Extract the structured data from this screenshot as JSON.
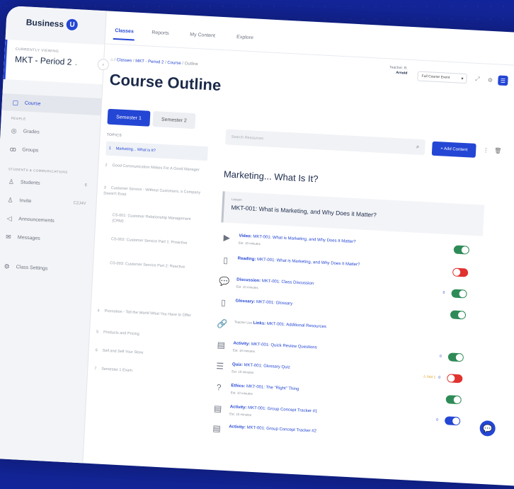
{
  "brand": {
    "name": "Business",
    "badge": "U"
  },
  "topnav": {
    "tabs": [
      {
        "label": "Classes"
      },
      {
        "label": "Reports"
      },
      {
        "label": "My Content"
      },
      {
        "label": "Explore"
      }
    ]
  },
  "class_selector": {
    "label": "CURRENTLY VIEWING",
    "value": "MKT - Period 2"
  },
  "sidebar": {
    "course": "Course",
    "section_people": "PEOPLE",
    "grades": "Grades",
    "groups": "Groups",
    "section_comm": "STUDENTS & COMMUNICATIONS",
    "students": "Students",
    "students_count": "6",
    "invite": "Invite",
    "invite_code": "C2J4V",
    "announcements": "Announcements",
    "messages": "Messages",
    "class_settings": "Class Settings"
  },
  "breadcrumb": {
    "home": "⌂",
    "classes": "Classes",
    "period": "MKT - Period 2",
    "course": "Course",
    "current": "Outline"
  },
  "page_title": "Course Outline",
  "header_right": {
    "teacher_label": "Teacher: R.",
    "teacher_name": "Arnold",
    "view_select": "Full Course Event"
  },
  "semesters": [
    "Semester 1",
    "Semester 2"
  ],
  "topics_label": "TOPICS",
  "topics": [
    {
      "num": "1",
      "label": "Marketing... What is It?"
    },
    {
      "num": "2",
      "label": "Good Communication Makes For A Good Manager"
    },
    {
      "num": "3",
      "label": "Customer Service - Without Customers, a Company Doesn't Exist"
    },
    {
      "num": "",
      "label": "CS-001: Customer Relationship Management (CRM)"
    },
    {
      "num": "",
      "label": "CS-002: Customer Service Part 1: Proactive"
    },
    {
      "num": "",
      "label": "CS-003: Customer Service Part 2: Reactive"
    },
    {
      "num": "4",
      "label": "Promotion - Tell the World What You Have to Offer"
    },
    {
      "num": "5",
      "label": "Products and Pricing"
    },
    {
      "num": "6",
      "label": "Sell and Sell Your Store"
    },
    {
      "num": "7",
      "label": "Semester 1 Exam"
    }
  ],
  "search": {
    "placeholder": "Search Resources"
  },
  "add_content": "+ Add Content",
  "section_title": "Marketing... What Is It?",
  "lesson": {
    "label": "Lesson",
    "title": "MKT-001: What is Marketing, and Why Does it Matter?"
  },
  "items": [
    {
      "icon": "▶",
      "icon_name": "video-icon",
      "kind": "Video:",
      "title": "MKT-001: What is Marketing, and Why Does It Matter?",
      "meta": "Est. 10 minutes",
      "toggle": "on",
      "count": ""
    },
    {
      "icon": "▯",
      "icon_name": "document-icon",
      "kind": "Reading:",
      "title": "MKT-001: What is Marketing, and Why Does It Matter?",
      "meta": "",
      "toggle": "off",
      "count": ""
    },
    {
      "icon": "💬",
      "icon_name": "discussion-icon",
      "kind": "Discussion:",
      "title": "MKT-001: Class Discussion",
      "meta": "Est. 10 minutes",
      "toggle": "on",
      "count": "0"
    },
    {
      "icon": "▯",
      "icon_name": "document-icon",
      "kind": "Glossary:",
      "title": "MKT-001: Glossary",
      "meta": "",
      "toggle": "on",
      "count": ""
    },
    {
      "icon": "🔗",
      "icon_name": "link-icon",
      "kind": "Links:",
      "prefix": "Teacher Use",
      "title": "MKT-001: Additional Resources",
      "meta": "",
      "toggle": "",
      "count": ""
    },
    {
      "icon": "▤",
      "icon_name": "activity-icon",
      "kind": "Activity:",
      "title": "MKT-001: Quick Review Questions",
      "meta": "Est. 10 minutes",
      "toggle": "on",
      "count": "0"
    },
    {
      "icon": "☰",
      "icon_name": "quiz-icon",
      "kind": "Quiz:",
      "title": "MKT-001: Glossary Quiz",
      "meta": "Est. 10 minutes",
      "toggle": "off",
      "count": "0",
      "warn": "⚠ Not 1"
    },
    {
      "icon": "?",
      "icon_name": "ethics-icon",
      "kind": "Ethics:",
      "title": "MKT-001: The \"Right\" Thing",
      "meta": "Est. 10 minutes",
      "toggle": "on",
      "count": ""
    },
    {
      "icon": "▤",
      "icon_name": "activity-icon",
      "kind": "Activity:",
      "title": "MKT-001: Group Concept Tracker #1",
      "meta": "Est. 10 minutes",
      "toggle": "blue",
      "count": "0"
    },
    {
      "icon": "▤",
      "icon_name": "activity-icon",
      "kind": "Activity:",
      "title": "MKT-001: Group Concept Tracker #2",
      "meta": "",
      "toggle": "",
      "count": ""
    }
  ]
}
